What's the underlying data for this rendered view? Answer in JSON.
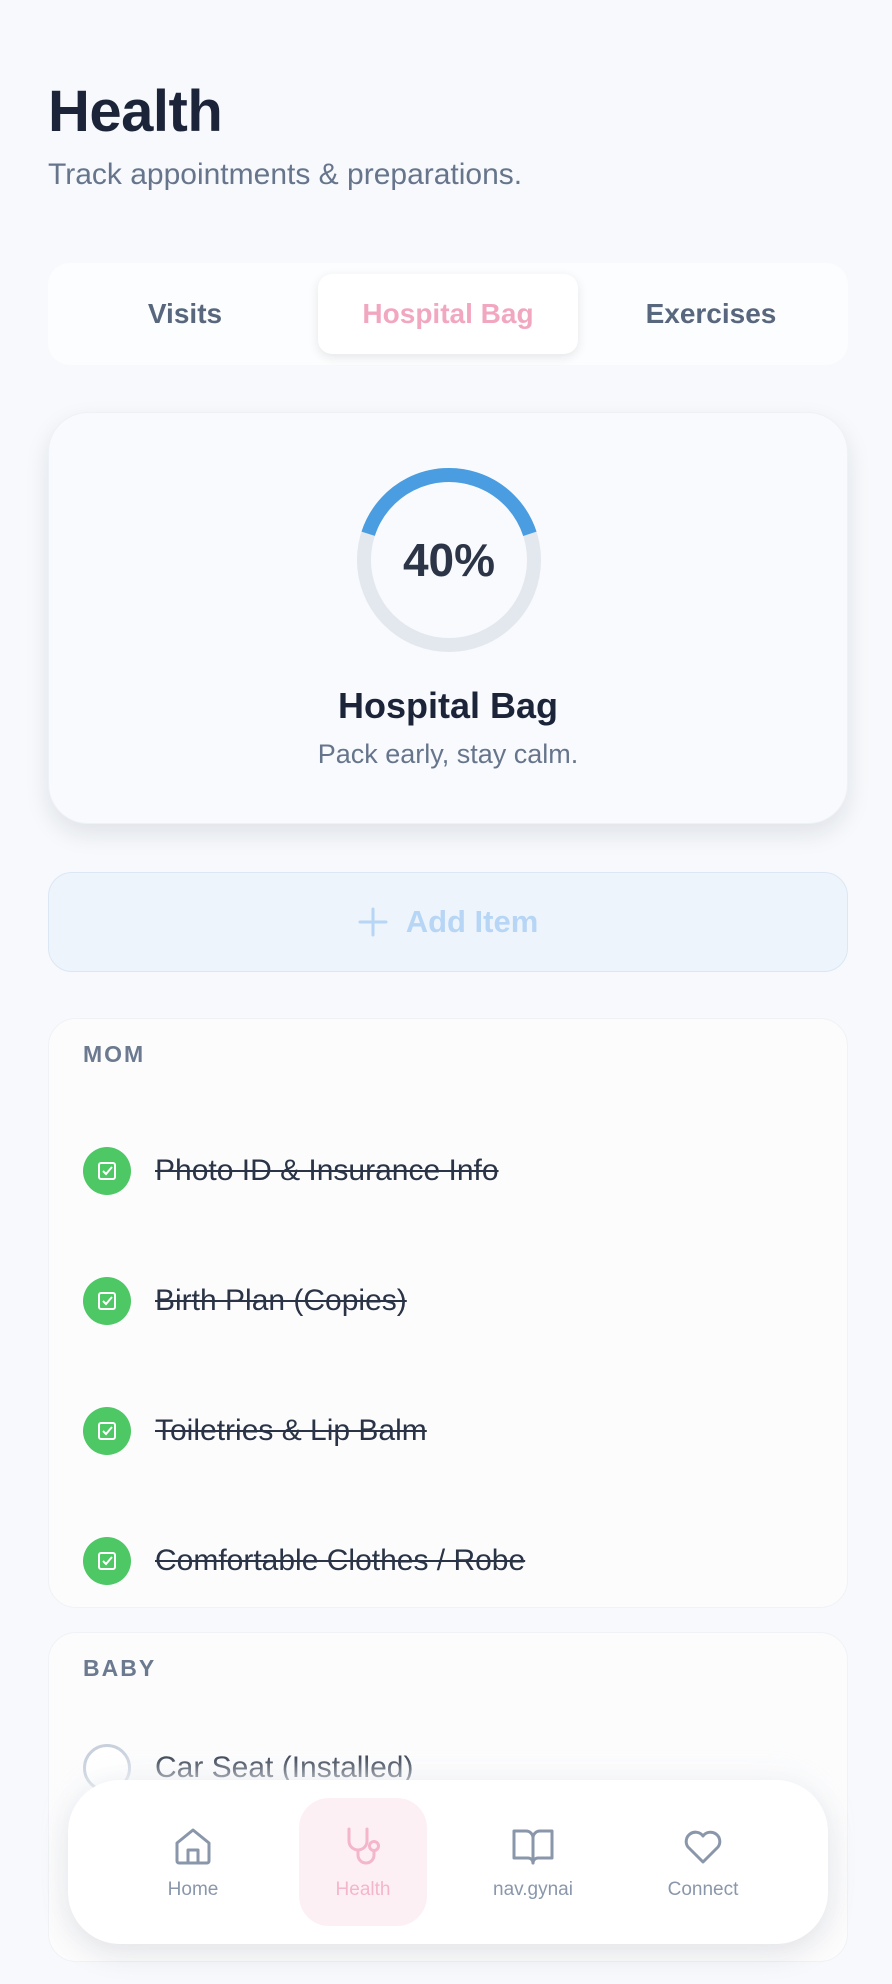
{
  "header": {
    "title": "Health",
    "subtitle": "Track appointments & preparations."
  },
  "tabs": [
    {
      "label": "Visits",
      "active": false
    },
    {
      "label": "Hospital Bag",
      "active": true
    },
    {
      "label": "Exercises",
      "active": false
    }
  ],
  "progress_card": {
    "percent_value": 0.4,
    "percent_label": "40%",
    "title": "Hospital Bag",
    "subtitle": "Pack early, stay calm.",
    "ring_color": "#4a9de0",
    "track_color": "#e3e8ef"
  },
  "add_button": {
    "label": "Add Item",
    "icon": "plus-icon"
  },
  "sections": {
    "mom": {
      "heading": "MOM",
      "items": [
        {
          "label": "Photo ID & Insurance Info",
          "checked": true
        },
        {
          "label": "Birth Plan (Copies)",
          "checked": true
        },
        {
          "label": "Toiletries & Lip Balm",
          "checked": true
        },
        {
          "label": "Comfortable Clothes / Robe",
          "checked": true
        }
      ]
    },
    "baby": {
      "heading": "BABY",
      "items": [
        {
          "label": "Car Seat (Installed)",
          "checked": false
        }
      ]
    }
  },
  "nav": [
    {
      "label": "Home",
      "icon": "home-icon",
      "active": false
    },
    {
      "label": "Health",
      "icon": "stethoscope-icon",
      "active": true
    },
    {
      "label": "nav.gynai",
      "icon": "book-icon",
      "active": false
    },
    {
      "label": "Connect",
      "icon": "heart-icon",
      "active": false
    }
  ],
  "colors": {
    "accent_pink": "#f2a7c0",
    "check_green": "#4ec765",
    "add_blue": "#b7d6f6"
  }
}
